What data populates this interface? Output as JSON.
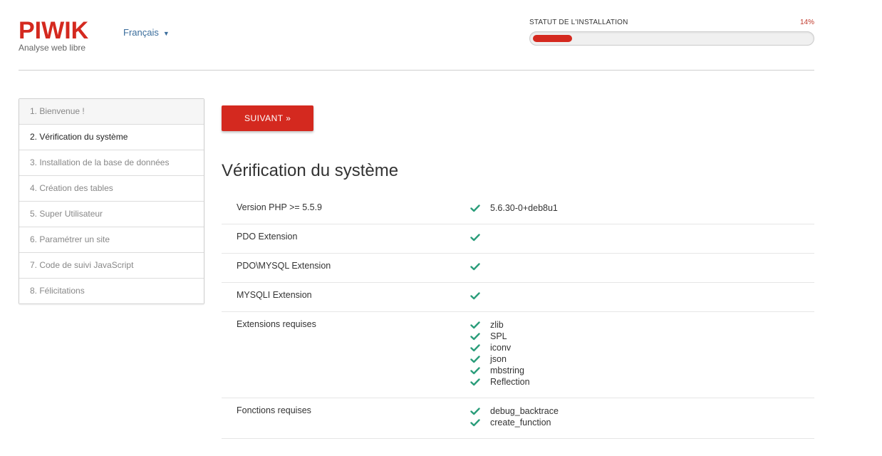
{
  "header": {
    "logo": "PIWIK",
    "tagline": "Analyse web libre",
    "language": "Français",
    "status_label": "STATUT DE L'INSTALLATION",
    "status_percent": "14%",
    "progress": 14
  },
  "sidebar": {
    "steps": [
      {
        "label": "1. Bienvenue !"
      },
      {
        "label": "2. Vérification du système"
      },
      {
        "label": "3. Installation de la base de données"
      },
      {
        "label": "4. Création des tables"
      },
      {
        "label": "5. Super Utilisateur"
      },
      {
        "label": "6. Paramétrer un site"
      },
      {
        "label": "7. Code de suivi JavaScript"
      },
      {
        "label": "8. Félicitations"
      }
    ]
  },
  "main": {
    "next_button": "SUIVANT »",
    "title": "Vérification du système",
    "checks": [
      {
        "label": "Version PHP >= 5.5.9",
        "values": [
          "5.6.30-0+deb8u1"
        ]
      },
      {
        "label": "PDO Extension",
        "values": [
          ""
        ]
      },
      {
        "label": "PDO\\MYSQL Extension",
        "values": [
          ""
        ]
      },
      {
        "label": "MYSQLI Extension",
        "values": [
          ""
        ]
      },
      {
        "label": "Extensions requises",
        "values": [
          "zlib",
          "SPL",
          "iconv",
          "json",
          "mbstring",
          "Reflection"
        ]
      },
      {
        "label": "Fonctions requises",
        "values": [
          "debug_backtrace",
          "create_function"
        ]
      }
    ]
  },
  "colors": {
    "accent": "#d4291f",
    "check": "#2a9d7a",
    "link": "#3a6d9c"
  }
}
